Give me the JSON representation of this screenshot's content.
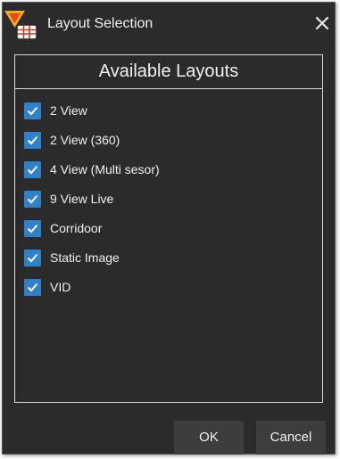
{
  "window": {
    "title": "Layout Selection",
    "close_icon": "close-icon"
  },
  "panel": {
    "header": "Available Layouts",
    "items": [
      {
        "label": "2 View",
        "checked": true
      },
      {
        "label": "2 View (360)",
        "checked": true
      },
      {
        "label": "4 View (Multi sesor)",
        "checked": true
      },
      {
        "label": "9 View Live",
        "checked": true
      },
      {
        "label": "Corridoor",
        "checked": true
      },
      {
        "label": "Static Image",
        "checked": true
      },
      {
        "label": "VID",
        "checked": true
      }
    ]
  },
  "buttons": {
    "ok": "OK",
    "cancel": "Cancel"
  },
  "colors": {
    "background": "#2b2b2b",
    "checkbox": "#2f82c8",
    "button": "#3d3d3d",
    "text": "#f0f0f0"
  }
}
